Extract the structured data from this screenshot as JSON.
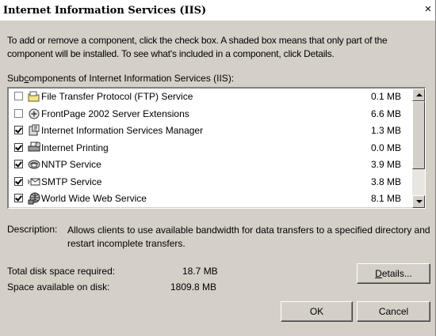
{
  "window": {
    "title": "Internet Information Services (IIS)",
    "close_glyph": "×"
  },
  "intro_text": "To add or remove a component, click the check box. A shaded box means that only part of the component will be installed. To see what's included in a component, click Details.",
  "subcomponents_label": {
    "before": "Sub",
    "access": "c",
    "after": "omponents of Internet Information Services (IIS):"
  },
  "components": [
    {
      "name": "File Transfer Protocol (FTP) Service",
      "size": "0.1 MB",
      "checked": false,
      "icon": "ftp-folder-icon"
    },
    {
      "name": "FrontPage 2002 Server Extensions",
      "size": "6.6 MB",
      "checked": false,
      "icon": "frontpage-icon"
    },
    {
      "name": "Internet Information Services Manager",
      "size": "1.3 MB",
      "checked": true,
      "icon": "iis-manager-icon"
    },
    {
      "name": "Internet Printing",
      "size": "0.0 MB",
      "checked": true,
      "icon": "printer-icon"
    },
    {
      "name": "NNTP Service",
      "size": "3.9 MB",
      "checked": true,
      "icon": "nntp-icon"
    },
    {
      "name": "SMTP Service",
      "size": "3.8 MB",
      "checked": true,
      "icon": "smtp-envelope-icon"
    },
    {
      "name": "World Wide Web Service",
      "size": "8.1 MB",
      "checked": true,
      "icon": "www-globe-icon"
    }
  ],
  "description": {
    "label": "Description:",
    "text": "Allows clients to use available bandwidth for data transfers to a specified directory and restart incomplete transfers."
  },
  "disk": {
    "required_label": "Total disk space required:",
    "required_value": "18.7 MB",
    "available_label": "Space available on disk:",
    "available_value": "1809.8 MB"
  },
  "buttons": {
    "details": {
      "before": "",
      "access": "D",
      "after": "etails..."
    },
    "ok": "OK",
    "cancel": "Cancel"
  }
}
